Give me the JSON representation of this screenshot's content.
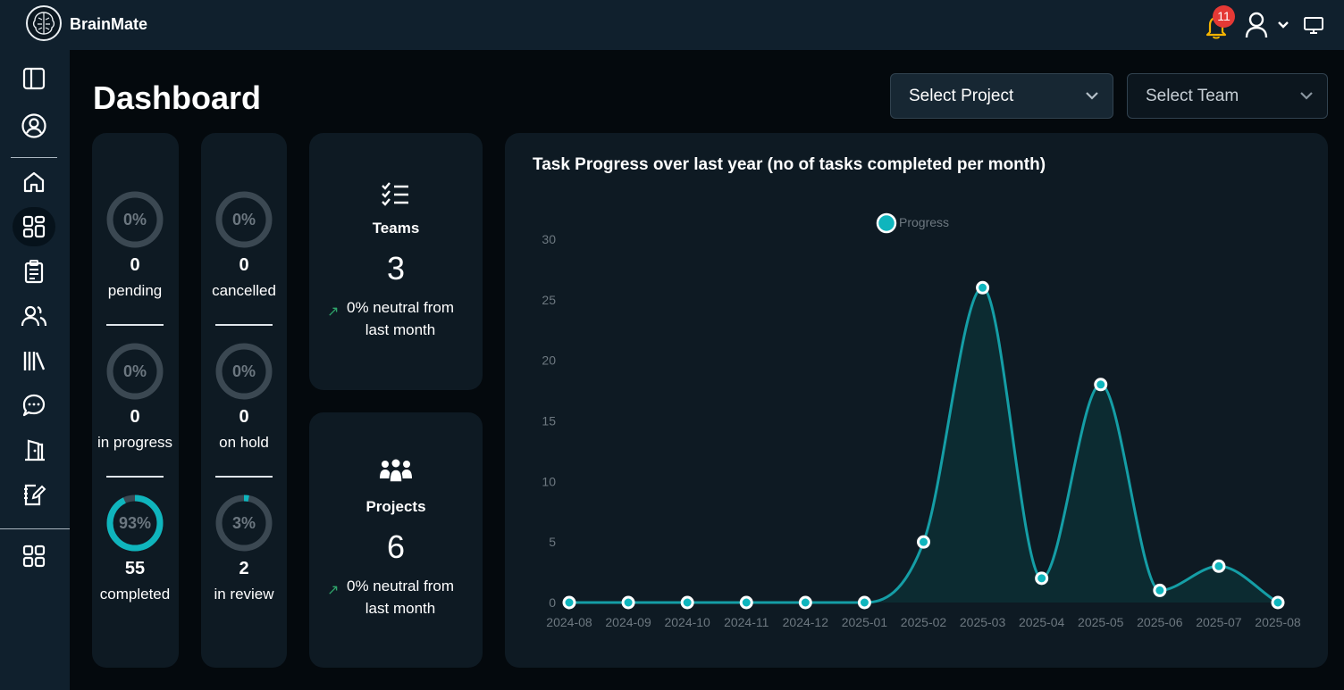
{
  "app": {
    "name": "BrainMate",
    "notification_count": "11"
  },
  "page": {
    "title": "Dashboard"
  },
  "filters": {
    "project_placeholder": "Select Project",
    "team_placeholder": "Select Team"
  },
  "sidebar": {
    "items": [
      {
        "icon": "sidebar-toggle-icon"
      },
      {
        "icon": "user-circle-icon"
      },
      {
        "icon": "home-icon"
      },
      {
        "icon": "dashboard-grid-icon",
        "active": true
      },
      {
        "icon": "clipboard-icon"
      },
      {
        "icon": "users-icon"
      },
      {
        "icon": "library-icon"
      },
      {
        "icon": "chat-icon"
      },
      {
        "icon": "door-exit-icon"
      },
      {
        "icon": "notebook-edit-icon"
      },
      {
        "icon": "apps-grid-icon"
      }
    ]
  },
  "task_stats": {
    "column1": [
      {
        "percent": "0%",
        "fraction": 0,
        "count": "0",
        "label": "pending"
      },
      {
        "percent": "0%",
        "fraction": 0,
        "count": "0",
        "label": "in progress"
      },
      {
        "percent": "93%",
        "fraction": 0.93,
        "count": "55",
        "label": "completed"
      }
    ],
    "column2": [
      {
        "percent": "0%",
        "fraction": 0,
        "count": "0",
        "label": "cancelled"
      },
      {
        "percent": "0%",
        "fraction": 0,
        "count": "0",
        "label": "on hold"
      },
      {
        "percent": "3%",
        "fraction": 0.03,
        "count": "2",
        "label": "in review"
      }
    ]
  },
  "teams": {
    "title": "Teams",
    "value": "3",
    "trend_arrow": "↗",
    "trend_line1": "0% neutral from",
    "trend_line2": "last month"
  },
  "projects": {
    "title": "Projects",
    "value": "6",
    "trend_arrow": "↗",
    "trend_line1": "0% neutral from",
    "trend_line2": "last month"
  },
  "colors": {
    "accent": "#0fb5bd",
    "line": "#159ea6",
    "ring_track": "#3b4852",
    "trend_green": "#2fa56b"
  },
  "chart_data": {
    "type": "area",
    "title": "Task Progress over last year (no of tasks completed per month)",
    "legend": "top-center",
    "series": [
      {
        "name": "Progress",
        "values": [
          0,
          0,
          0,
          0,
          0,
          0,
          5,
          26,
          2,
          18,
          1,
          3,
          0
        ]
      }
    ],
    "x": [
      "2024-08",
      "2024-09",
      "2024-10",
      "2024-11",
      "2024-12",
      "2025-01",
      "2025-02",
      "2025-03",
      "2025-04",
      "2025-05",
      "2025-06",
      "2025-07",
      "2025-08"
    ],
    "yticks": [
      "0",
      "5",
      "10",
      "15",
      "20",
      "25",
      "30"
    ],
    "ylim": [
      0,
      30
    ],
    "grid": false
  }
}
